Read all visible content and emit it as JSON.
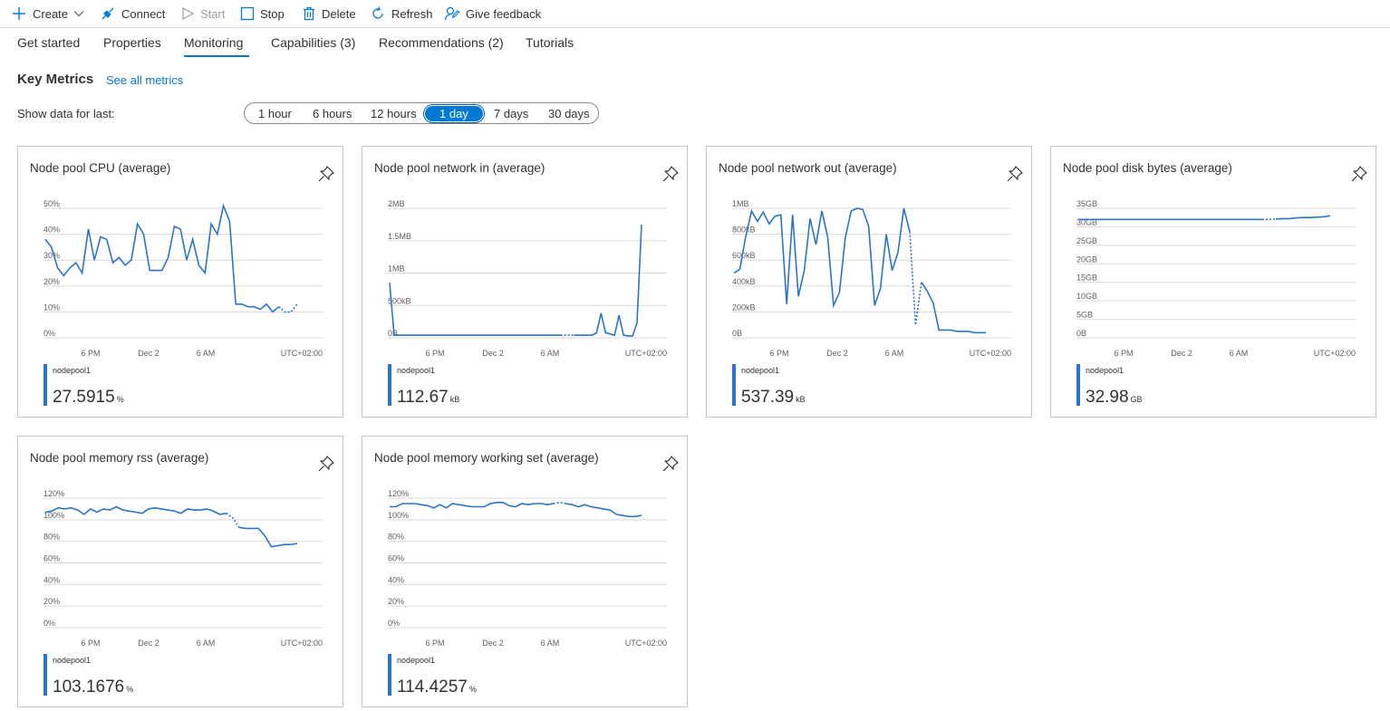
{
  "toolbar": {
    "create": "Create",
    "connect": "Connect",
    "start": "Start",
    "stop": "Stop",
    "delete": "Delete",
    "refresh": "Refresh",
    "feedback": "Give feedback"
  },
  "tabs": [
    "Get started",
    "Properties",
    "Monitoring",
    "Capabilities (3)",
    "Recommendations (2)",
    "Tutorials"
  ],
  "active_tab": "Monitoring",
  "key_metrics": {
    "title": "Key Metrics",
    "see_all": "See all metrics",
    "show_label": "Show data for last:",
    "ranges": [
      "1 hour",
      "6 hours",
      "12 hours",
      "1 day",
      "7 days",
      "30 days"
    ],
    "selected_range": "1 day"
  },
  "colors": {
    "accent": "#0078d4",
    "series": "#2b74c9"
  },
  "icons": {
    "create": "plus-icon",
    "connect": "plug-icon",
    "start": "play-icon",
    "stop": "stop-icon",
    "delete": "trash-icon",
    "refresh": "refresh-icon",
    "feedback": "feedback-icon",
    "pin": "pin-icon"
  },
  "cards": [
    {
      "title": "Node pool CPU (average)",
      "legend": "nodepool1",
      "value": "27.5915",
      "unit": "%"
    },
    {
      "title": "Node pool network in (average)",
      "legend": "nodepool1",
      "value": "112.67",
      "unit": "kB"
    },
    {
      "title": "Node pool network out (average)",
      "legend": "nodepool1",
      "value": "537.39",
      "unit": "kB"
    },
    {
      "title": "Node pool disk bytes (average)",
      "legend": "nodepool1",
      "value": "32.98",
      "unit": "GB"
    },
    {
      "title": "Node pool memory rss (average)",
      "legend": "nodepool1",
      "value": "103.1676",
      "unit": "%"
    },
    {
      "title": "Node pool memory working set (average)",
      "legend": "nodepool1",
      "value": "114.4257",
      "unit": "%"
    }
  ],
  "chart_data": [
    {
      "type": "line",
      "title": "Node pool CPU (average)",
      "x_ticks": [
        "6 PM",
        "Dec 2",
        "6 AM",
        "UTC+02:00"
      ],
      "y_ticks": [
        "0%",
        "10%",
        "20%",
        "30%",
        "40%",
        "50%"
      ],
      "ylim": [
        0,
        50
      ],
      "grid": true,
      "gap": [
        38,
        41
      ],
      "series": [
        {
          "name": "nodepool1",
          "values": [
            38,
            35,
            27,
            24,
            27,
            29,
            25,
            42,
            30,
            39,
            38,
            29,
            31,
            28,
            30,
            44,
            40,
            26,
            26,
            26,
            31,
            43,
            42,
            30,
            38,
            28,
            25,
            44,
            40,
            51,
            45,
            13,
            13,
            12,
            12,
            11,
            13,
            10,
            12,
            10,
            10,
            13
          ]
        }
      ]
    },
    {
      "type": "line",
      "title": "Node pool network in (average)",
      "x_ticks": [
        "6 PM",
        "Dec 2",
        "6 AM",
        "UTC+02:00"
      ],
      "y_ticks": [
        "0B",
        "500kB",
        "1MB",
        "1.5MB",
        "2MB"
      ],
      "ylim": [
        0,
        2000
      ],
      "grid": true,
      "gap": [
        38,
        41
      ],
      "series": [
        {
          "name": "nodepool1",
          "values": [
            850,
            40,
            40,
            40,
            40,
            40,
            40,
            40,
            40,
            40,
            40,
            40,
            40,
            40,
            40,
            40,
            40,
            40,
            40,
            40,
            40,
            40,
            40,
            40,
            40,
            40,
            40,
            40,
            40,
            40,
            40,
            40,
            40,
            40,
            40,
            40,
            40,
            40,
            40,
            40,
            40,
            40,
            40,
            40,
            40,
            40,
            80,
            380,
            80,
            60,
            40,
            350,
            40,
            30,
            30,
            230,
            1750
          ]
        }
      ]
    },
    {
      "type": "line",
      "title": "Node pool network out (average)",
      "x_ticks": [
        "6 PM",
        "Dec 2",
        "6 AM",
        "UTC+02:00"
      ],
      "y_ticks": [
        "0B",
        "200kB",
        "400kB",
        "600kB",
        "800kB",
        "1MB"
      ],
      "ylim": [
        0,
        1000
      ],
      "grid": true,
      "gap": [
        30,
        32
      ],
      "series": [
        {
          "name": "nodepool1",
          "values": [
            500,
            530,
            780,
            980,
            900,
            970,
            880,
            940,
            950,
            260,
            950,
            320,
            520,
            920,
            720,
            980,
            780,
            250,
            350,
            770,
            980,
            1000,
            990,
            860,
            250,
            380,
            800,
            520,
            660,
            1000,
            820,
            100,
            430,
            360,
            270,
            60,
            60,
            60,
            50,
            50,
            50,
            40,
            40,
            40
          ]
        }
      ]
    },
    {
      "type": "line",
      "title": "Node pool disk bytes (average)",
      "x_ticks": [
        "6 PM",
        "Dec 2",
        "6 AM",
        "UTC+02:00"
      ],
      "y_ticks": [
        "0B",
        "5GB",
        "10GB",
        "15GB",
        "20GB",
        "25GB",
        "30GB",
        "35GB"
      ],
      "ylim": [
        0,
        35
      ],
      "grid": true,
      "gap": [
        27,
        29
      ],
      "series": [
        {
          "name": "nodepool1",
          "values": [
            32.0,
            32.0,
            32.0,
            32.0,
            32.0,
            32.0,
            32.0,
            32.0,
            32.0,
            32.0,
            32.0,
            32.0,
            32.0,
            32.0,
            32.0,
            32.0,
            32.0,
            32.0,
            32.0,
            32.0,
            32.0,
            32.0,
            32.0,
            32.0,
            32.0,
            32.0,
            32.0,
            32.0,
            32.0,
            32.1,
            32.2,
            32.2,
            32.4,
            32.5,
            32.5,
            32.6,
            32.7,
            33.0
          ]
        }
      ]
    },
    {
      "type": "line",
      "title": "Node pool memory rss (average)",
      "x_ticks": [
        "6 PM",
        "Dec 2",
        "6 AM",
        "UTC+02:00"
      ],
      "y_ticks": [
        "0%",
        "20%",
        "40%",
        "60%",
        "80%",
        "100%",
        "120%"
      ],
      "ylim": [
        0,
        120
      ],
      "grid": true,
      "gap": [
        28,
        30
      ],
      "series": [
        {
          "name": "nodepool1",
          "values": [
            107,
            108,
            111,
            110,
            111,
            109,
            105,
            110,
            107,
            110,
            109,
            112,
            109,
            108,
            107,
            106,
            110,
            111,
            110,
            109,
            108,
            106,
            110,
            109,
            109,
            110,
            108,
            105,
            106,
            102,
            93,
            92,
            92,
            92,
            85,
            75,
            76,
            77,
            77,
            78
          ]
        }
      ]
    },
    {
      "type": "line",
      "title": "Node pool memory working set (average)",
      "x_ticks": [
        "6 PM",
        "Dec 2",
        "6 AM",
        "UTC+02:00"
      ],
      "y_ticks": [
        "0%",
        "20%",
        "40%",
        "60%",
        "80%",
        "100%",
        "120%"
      ],
      "ylim": [
        0,
        120
      ],
      "grid": true,
      "gap": [
        26,
        28
      ],
      "series": [
        {
          "name": "nodepool1",
          "values": [
            112,
            112,
            115,
            115,
            115,
            114,
            113,
            111,
            114,
            111,
            115,
            114,
            113,
            112,
            112,
            112,
            115,
            116,
            116,
            113,
            112,
            115,
            114,
            115,
            115,
            114,
            115,
            116,
            115,
            114,
            112,
            114,
            112,
            111,
            110,
            109,
            105,
            104,
            103,
            103,
            104
          ]
        }
      ]
    }
  ]
}
